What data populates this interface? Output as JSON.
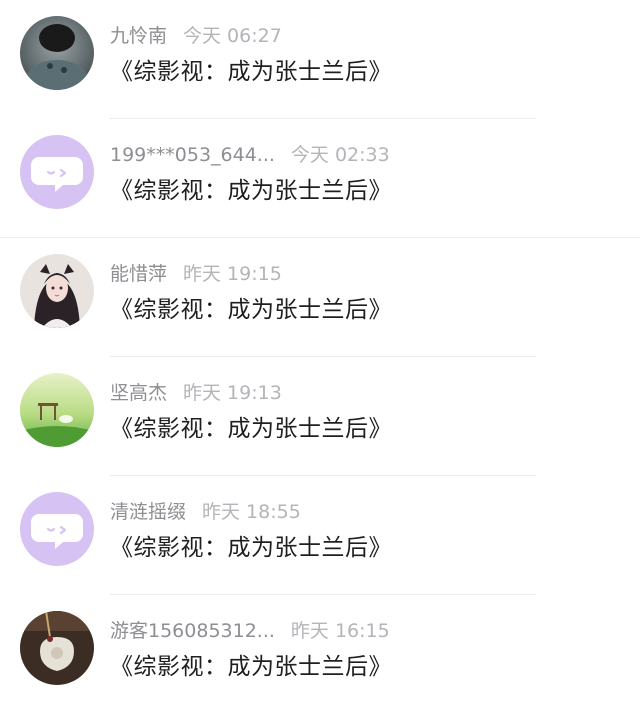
{
  "comments": [
    {
      "username": "九怜南",
      "time": "今天 06:27",
      "text": "《综影视：成为张士兰后》",
      "avatar": "dark-photo-avatar"
    },
    {
      "username": "199***053_644...",
      "time": "今天 02:33",
      "text": "《综影视：成为张士兰后》",
      "avatar": "default-chat-bubble-avatar"
    },
    {
      "username": "能惜萍",
      "time": "昨天 19:15",
      "text": "《综影视：成为张士兰后》",
      "avatar": "illustrated-girl-avatar"
    },
    {
      "username": "坚高杰",
      "time": "昨天 19:13",
      "text": "《综影视：成为张士兰后》",
      "avatar": "green-field-avatar"
    },
    {
      "username": "清涟摇缀",
      "time": "昨天 18:55",
      "text": "《综影视：成为张士兰后》",
      "avatar": "default-chat-bubble-avatar"
    },
    {
      "username": "游客156085312...",
      "time": "昨天 16:15",
      "text": "《综影视：成为张士兰后》",
      "avatar": "jade-pendant-avatar"
    }
  ],
  "colors": {
    "username": "#8e8e93",
    "time": "#b4b4b9",
    "text": "#1f1f1f",
    "default_avatar_bg": "#d6c3f3"
  }
}
